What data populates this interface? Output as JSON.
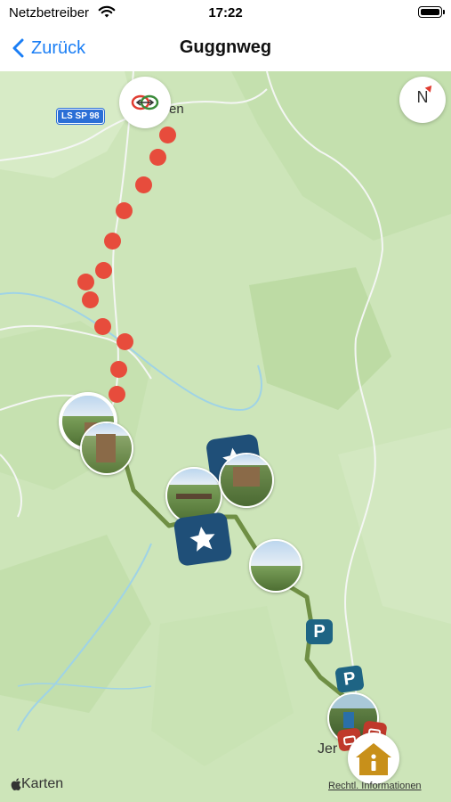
{
  "status_bar": {
    "carrier": "Netzbetreiber",
    "time": "17:22"
  },
  "nav": {
    "back_label": "Zurück",
    "title": "Guggnweg"
  },
  "map": {
    "road_label": "LS SP 98",
    "place_top": "en",
    "place_bottom": "Jer",
    "compass_label": "N",
    "parking_label": "P",
    "attribution": "Karten",
    "legal_link": "Rechtl. Informationen",
    "route_color": "#6f8f44",
    "dot_color": "#e74c3c",
    "poi_badge_color": "#1f4f78",
    "parking_badge_color": "#1e6484",
    "info_color": "#c8901a"
  }
}
